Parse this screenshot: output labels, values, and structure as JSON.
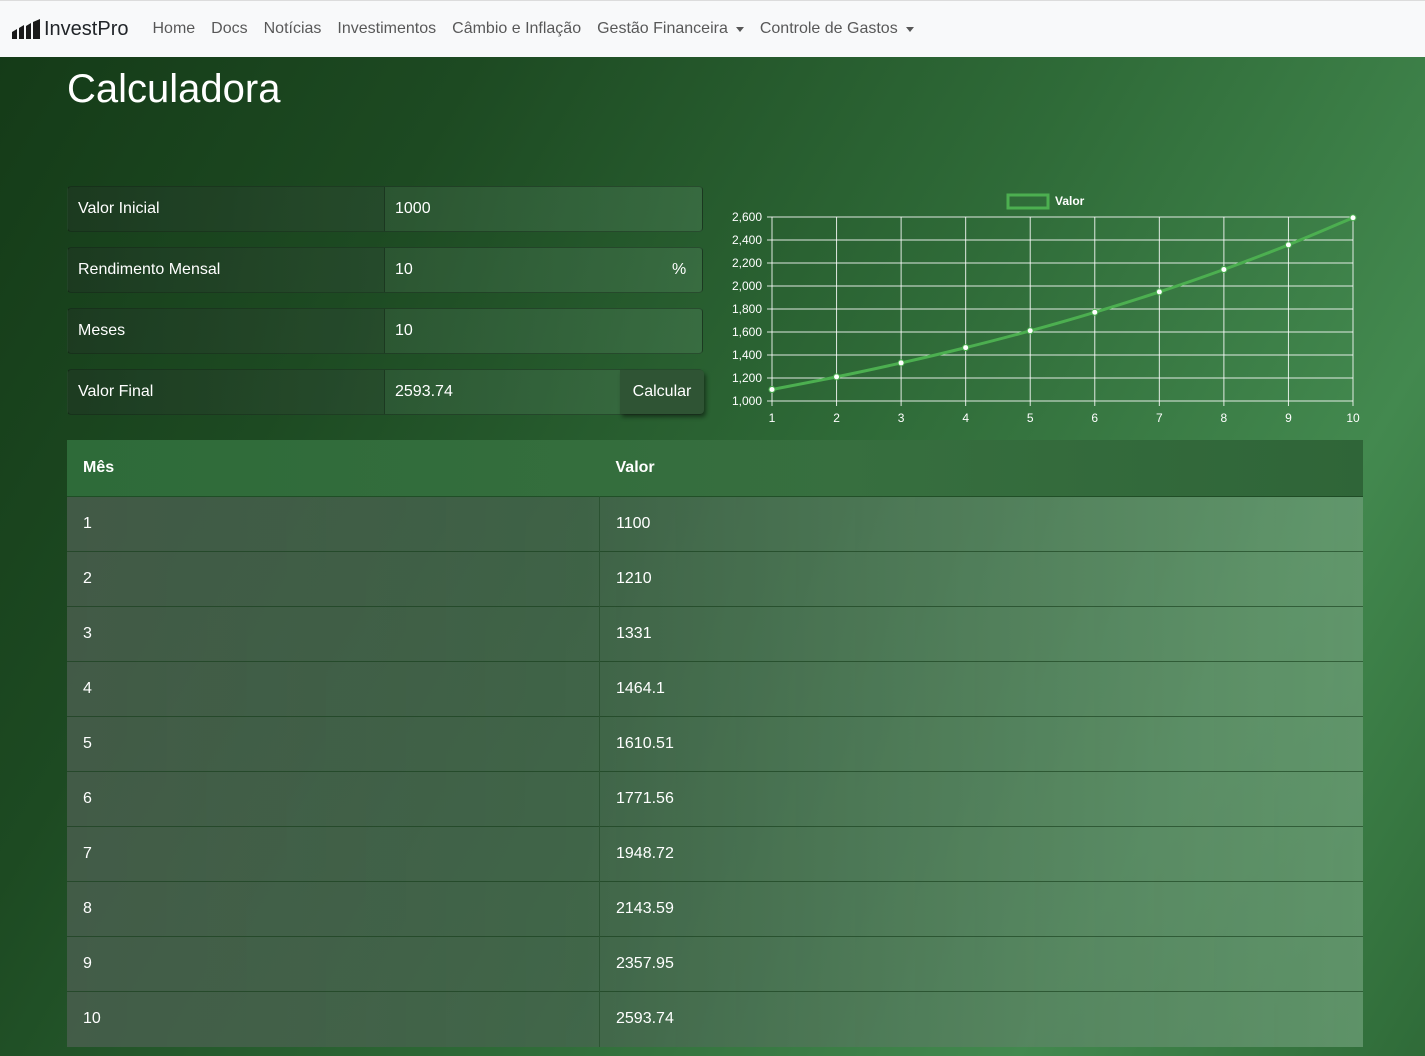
{
  "nav": {
    "brand": "InvestPro",
    "items": [
      {
        "label": "Home"
      },
      {
        "label": "Docs"
      },
      {
        "label": "Notícias"
      },
      {
        "label": "Investimentos"
      },
      {
        "label": "Câmbio e Inflação"
      },
      {
        "label": "Gestão Financeira"
      },
      {
        "label": "Controle de Gastos"
      }
    ]
  },
  "page": {
    "title": "Calculadora"
  },
  "form": {
    "initial_label": "Valor Inicial",
    "initial_value": "1000",
    "rate_label": "Rendimento Mensal",
    "rate_value": "10",
    "rate_suffix": "%",
    "months_label": "Meses",
    "months_value": "10",
    "final_label": "Valor Final",
    "final_value": "2593.74",
    "calc_button": "Calcular"
  },
  "chart_data": {
    "type": "line",
    "x": [
      1,
      2,
      3,
      4,
      5,
      6,
      7,
      8,
      9,
      10
    ],
    "series": [
      {
        "name": "Valor",
        "values": [
          1100,
          1210,
          1331,
          1464.1,
          1610.51,
          1771.56,
          1948.72,
          2143.59,
          2357.95,
          2593.74
        ],
        "color": "#4caf50"
      }
    ],
    "ylim": [
      1000,
      2600
    ],
    "yticks": [
      "1,000",
      "1,200",
      "1,400",
      "1,600",
      "1,800",
      "2,000",
      "2,200",
      "2,400",
      "2,600"
    ],
    "xticks": [
      "1",
      "2",
      "3",
      "4",
      "5",
      "6",
      "7",
      "8",
      "9",
      "10"
    ],
    "legend": "top-center",
    "grid": true
  },
  "table": {
    "headers": [
      "Mês",
      "Valor"
    ],
    "rows": [
      [
        "1",
        "1100"
      ],
      [
        "2",
        "1210"
      ],
      [
        "3",
        "1331"
      ],
      [
        "4",
        "1464.1"
      ],
      [
        "5",
        "1610.51"
      ],
      [
        "6",
        "1771.56"
      ],
      [
        "7",
        "1948.72"
      ],
      [
        "8",
        "2143.59"
      ],
      [
        "9",
        "2357.95"
      ],
      [
        "10",
        "2593.74"
      ]
    ]
  }
}
